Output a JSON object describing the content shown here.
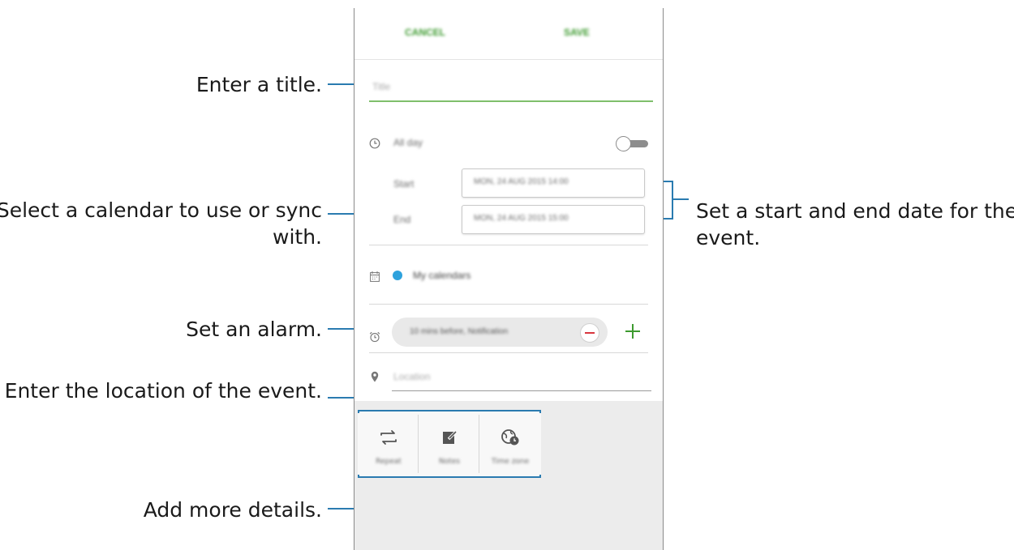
{
  "callouts": {
    "title": "Enter a title.",
    "calendar_line1": "Select a calendar to use or sync",
    "calendar_line2": "with.",
    "alarm": "Set an alarm.",
    "location": "Enter the location of the event.",
    "details": "Add more details.",
    "dates_line1": "Set a start and end date for the",
    "dates_line2": "event."
  },
  "screen": {
    "cancel_label": "CANCEL",
    "save_label": "SAVE",
    "title_placeholder": "Title",
    "allday_label": "All day",
    "start_label": "Start",
    "end_label": "End",
    "start_value": "MON, 24 AUG 2015   14:00",
    "end_value": "MON, 24 AUG 2015   15:00",
    "calendar_name": "My calendars",
    "alarm_value": "10 mins before, Notification",
    "location_placeholder": "Location",
    "tools": [
      "Repeat",
      "Notes",
      "Time zone"
    ]
  },
  "colors": {
    "accent_green": "#3d9a2f",
    "calendar_dot": "#2ea2dd",
    "remove_red": "#d9363e",
    "leader_blue": "#2a7bb0"
  }
}
